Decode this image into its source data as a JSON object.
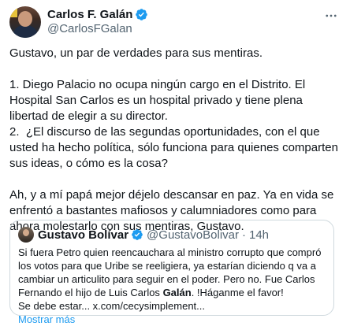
{
  "author": {
    "display_name": "Carlos F. Galán",
    "handle": "@CarlosFGalan",
    "verified_icon": "verified-badge-icon",
    "badge_color": "#1d9bf0"
  },
  "more_icon": "more-horizontal-icon",
  "post_text": "Gustavo, un par de verdades para sus mentiras.\n\n1. Diego Palacio no ocupa ningún cargo en el Distrito. El Hospital San Carlos es un hospital privado y tiene plena libertad de elegir a su director.\n2.  ¿El discurso de las segundas oportunidades, con el que usted ha hecho política, sólo funciona para quienes comparten sus ideas, o cómo es la cosa?\n\nAh, y a mí papá mejor déjelo descansar en paz. Ya en vida se enfrentó a bastantes mafiosos y calumniadores como para ahora molestarlo con sus mentiras, Gustavo.",
  "quoted": {
    "display_name": "Gustavo Bolívar",
    "handle": "@GustavoBolivar",
    "separator": "·",
    "time": "14h",
    "text_plain": "Si fuera Petro quien reencauchara al ministro corrupto que compró los votos para que Uribe se reeligiera, ya estarían diciendo q va a cambiar un articulito para seguir en el poder. Pero no. Fue Carlos Fernando el hijo de Luis Carlos ",
    "text_bold": "Galán",
    "text_after_bold": ". !Háganme el favor!\nSe debe estar... x.com/cecysimplement...",
    "show_more": "Mostrar más"
  }
}
